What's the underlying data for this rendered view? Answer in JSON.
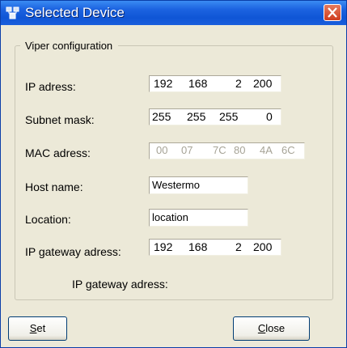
{
  "window": {
    "title": "Selected Device"
  },
  "group": {
    "legend": "Viper configuration"
  },
  "fields": {
    "ip": {
      "label": "IP adress:",
      "octets": [
        "192",
        "168",
        "2",
        "200"
      ]
    },
    "subnet": {
      "label": "Subnet mask:",
      "octets": [
        "255",
        "255",
        "255",
        "0"
      ]
    },
    "mac": {
      "label": "MAC adress:",
      "octets": [
        "00",
        "07",
        "7C",
        "80",
        "4A",
        "6C"
      ]
    },
    "host": {
      "label": "Host name:",
      "value": "Westermo"
    },
    "location": {
      "label": "Location:",
      "value": "location"
    },
    "gateway": {
      "label": "IP gateway adress:",
      "octets": [
        "192",
        "168",
        "2",
        "200"
      ]
    },
    "gateway_info": {
      "label": "IP gateway adress:"
    }
  },
  "buttons": {
    "set": {
      "accel": "S",
      "rest": "et"
    },
    "close": {
      "accel": "C",
      "rest": "lose"
    }
  }
}
